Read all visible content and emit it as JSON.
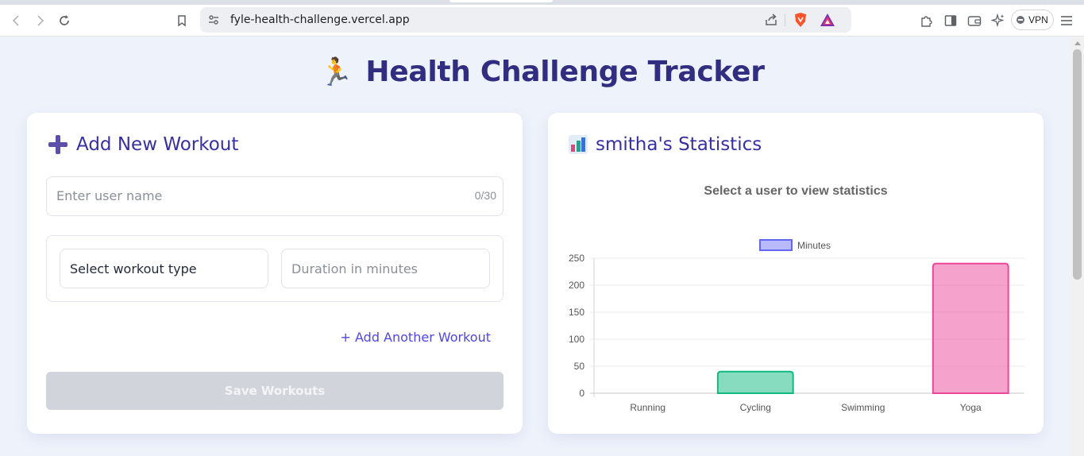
{
  "browser": {
    "url": "fyle-health-challenge.vercel.app",
    "vpn_label": "VPN",
    "icons": [
      "back-icon",
      "forward-icon",
      "reload-icon",
      "bookmark-icon",
      "site-settings-icon",
      "share-icon",
      "brave-shield-icon",
      "brave-rewards-icon",
      "extensions-icon",
      "sidebar-icon",
      "wallet-icon",
      "leo-ai-icon",
      "menu-icon"
    ]
  },
  "page": {
    "title": "Health Challenge Tracker",
    "title_emoji": "🏃"
  },
  "form": {
    "heading": "Add New Workout",
    "username_placeholder": "Enter user name",
    "username_counter": "0/30",
    "workout_type_selected": "Select workout type",
    "duration_placeholder": "Duration in minutes",
    "add_another_label": "+ Add Another Workout",
    "save_label": "Save Workouts"
  },
  "stats": {
    "heading": "smitha's Statistics"
  },
  "colors": {
    "title": "#312e81",
    "accent": "#4f46e5",
    "running": "#a5b4fc",
    "cycling": "#10b981",
    "yoga": "#ec4899"
  },
  "chart_data": {
    "type": "bar",
    "title": "Select a user to view statistics",
    "categories": [
      "Running",
      "Cycling",
      "Swimming",
      "Yoga"
    ],
    "series": [
      {
        "name": "Minutes",
        "values": [
          0,
          40,
          0,
          240
        ]
      }
    ],
    "ylim": [
      0,
      250
    ],
    "yticks": [
      0,
      50,
      100,
      150,
      200,
      250
    ],
    "legend": "top",
    "grid": true
  }
}
